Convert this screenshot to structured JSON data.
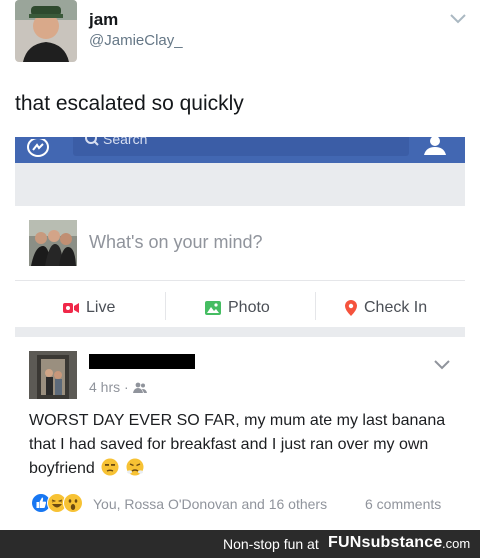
{
  "tweet": {
    "display_name": "jam",
    "handle": "@JamieClay_",
    "text": "that escalated so quickly",
    "avatar_icon": "profile-photo"
  },
  "facebook": {
    "search_placeholder": "Search",
    "brand_blue": "#4267b2",
    "composer": {
      "placeholder": "What's on your mind?",
      "actions": [
        {
          "label": "Live",
          "icon": "live-video-icon",
          "color": "#f02849"
        },
        {
          "label": "Photo",
          "icon": "photo-icon",
          "color": "#45bd62"
        },
        {
          "label": "Check In",
          "icon": "location-pin-icon",
          "color": "#f5533d"
        }
      ]
    },
    "post": {
      "time": "4 hrs",
      "privacy_icon": "friends-icon",
      "body": "WORST DAY EVER SO FAR, my mum ate my last banana that I had saved for breakfast and I just ran over my own boyfriend",
      "emojis": [
        "unamused-face",
        "face-with-steam"
      ],
      "reaction_icons": [
        "like-icon",
        "haha-icon",
        "wow-icon"
      ],
      "reaction_summary": "You, Rossa O'Donovan and 16 others",
      "comments": "6 comments"
    }
  },
  "footer": {
    "tagline": "Non-stop fun at",
    "brand": "FUNsubstance",
    "domain": ".com"
  }
}
